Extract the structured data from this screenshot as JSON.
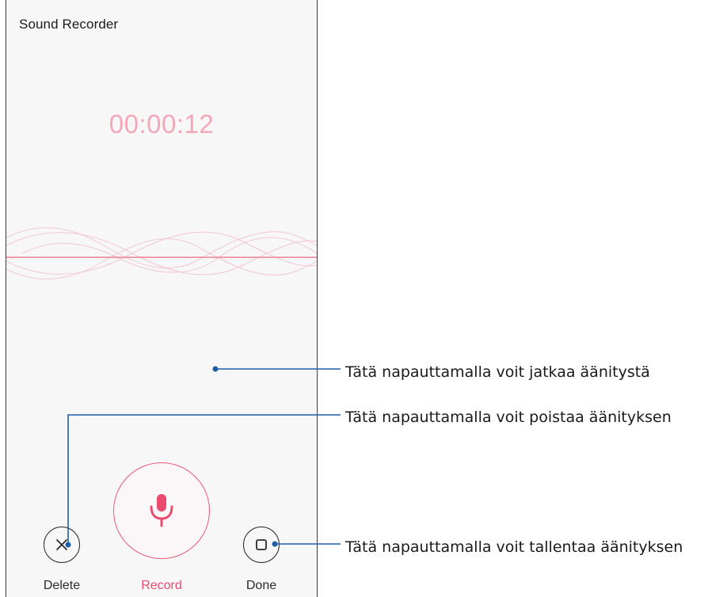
{
  "app": {
    "title": "Sound Recorder"
  },
  "recorder": {
    "elapsed_time": "00:00:12"
  },
  "controls": {
    "delete_label": "Delete",
    "record_label": "Record",
    "done_label": "Done"
  },
  "icons": {
    "delete": "close-icon",
    "record": "microphone-icon",
    "done": "stop-square-icon"
  },
  "annotations": {
    "delete_text": "Tätä napauttamalla voit poistaa äänityksen",
    "record_text": "Tätä napauttamalla voit jatkaa äänitystä",
    "done_text": "Tätä napauttamalla voit tallentaa äänityksen"
  },
  "colors": {
    "accent": "#ea4a6e",
    "timer": "#f4a7b8",
    "callout_line": "#1f5fa8"
  }
}
